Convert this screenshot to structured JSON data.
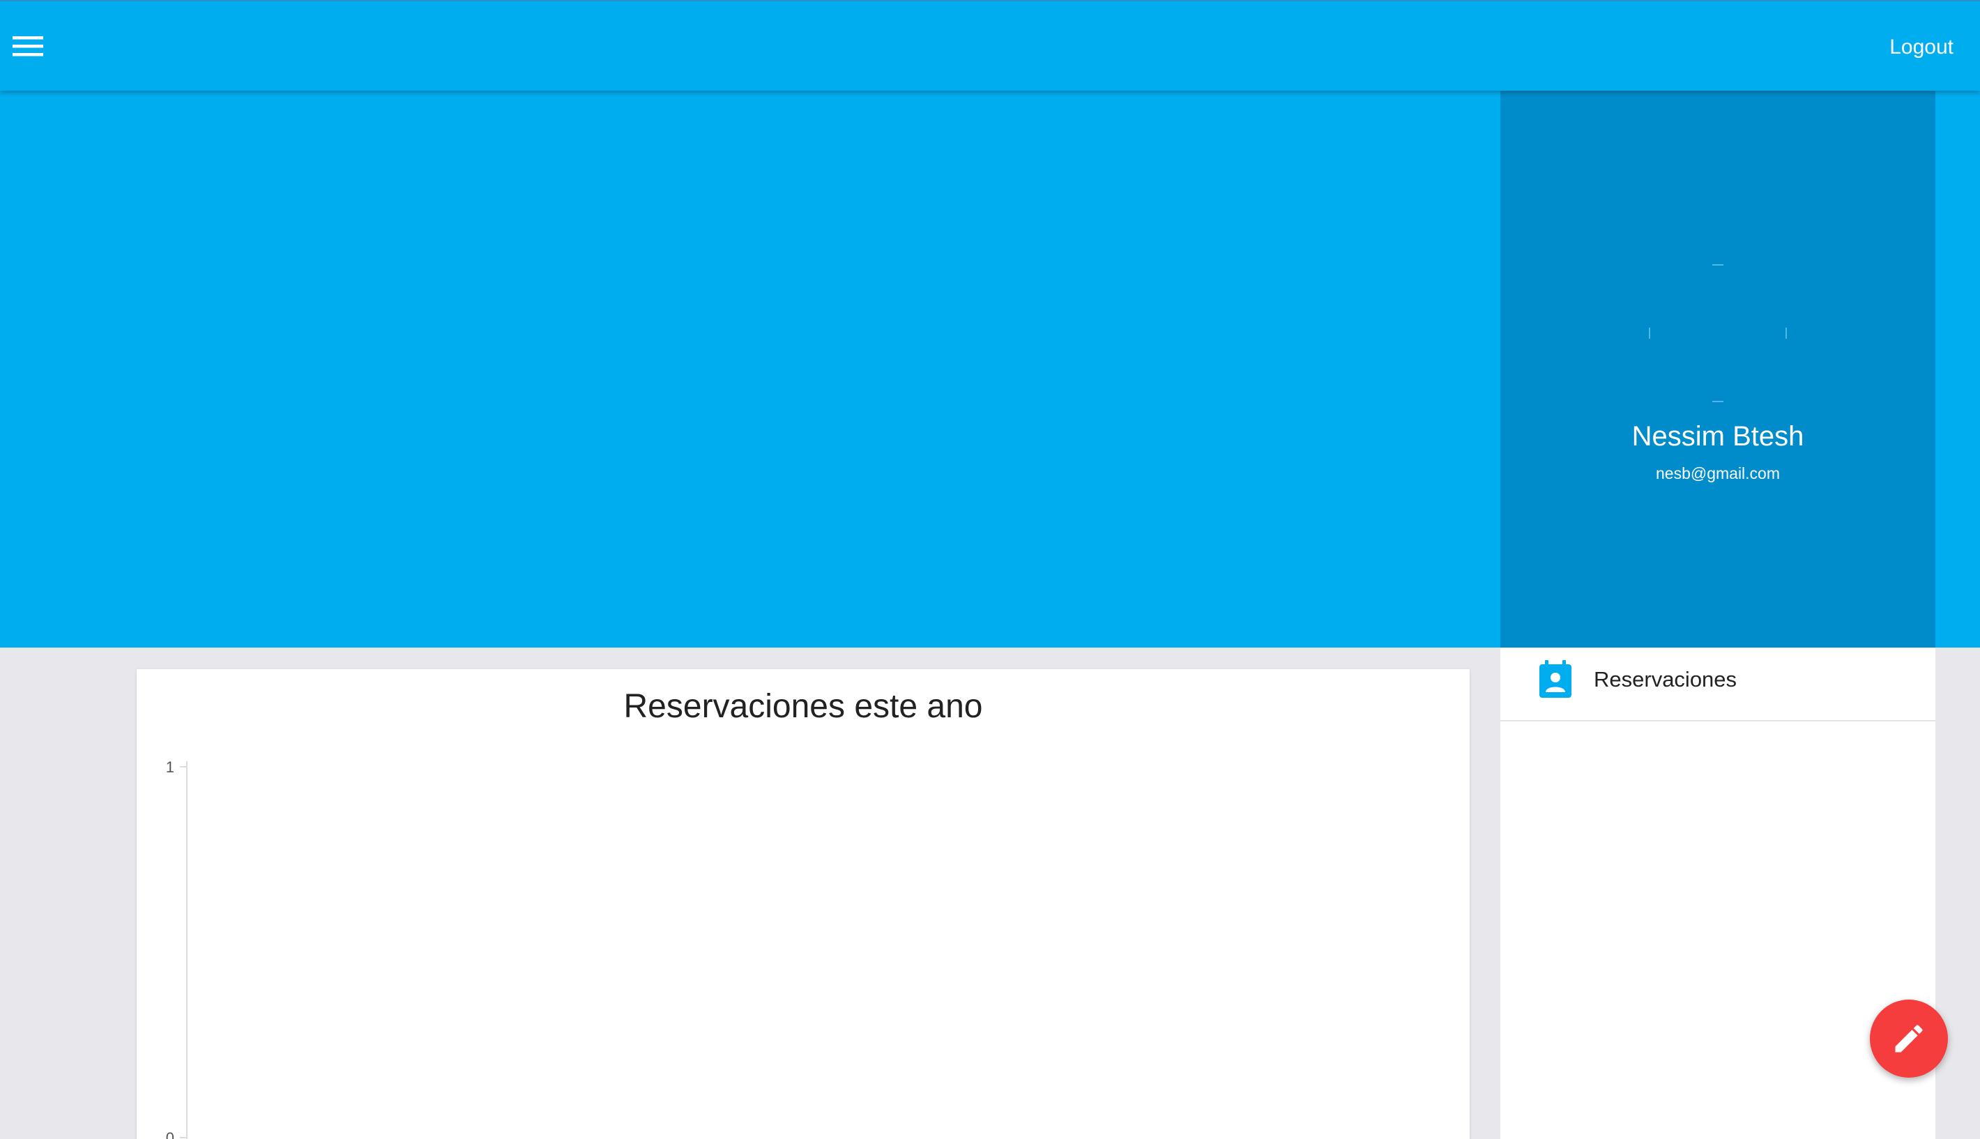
{
  "toolbar": {
    "menu_icon": "hamburger-menu-icon",
    "logout_label": "Logout",
    "color": "#00adef"
  },
  "profile": {
    "name": "Nessim Btesh",
    "email": "nesb@gmail.com",
    "panel_color": "#008bca"
  },
  "nav": {
    "items": [
      {
        "label": "Reservaciones",
        "icon": "calendar-person-icon",
        "icon_color": "#00adef"
      }
    ]
  },
  "chart_data": {
    "type": "line",
    "title": "Reservaciones este ano",
    "xlabel": "",
    "ylabel": "",
    "ylim": [
      0,
      1
    ],
    "y_ticks": [
      "1",
      "0"
    ],
    "x_tick_count": 12,
    "series": [],
    "grid": false
  },
  "fab": {
    "icon": "pencil-edit-icon",
    "color": "#f53d3d"
  }
}
